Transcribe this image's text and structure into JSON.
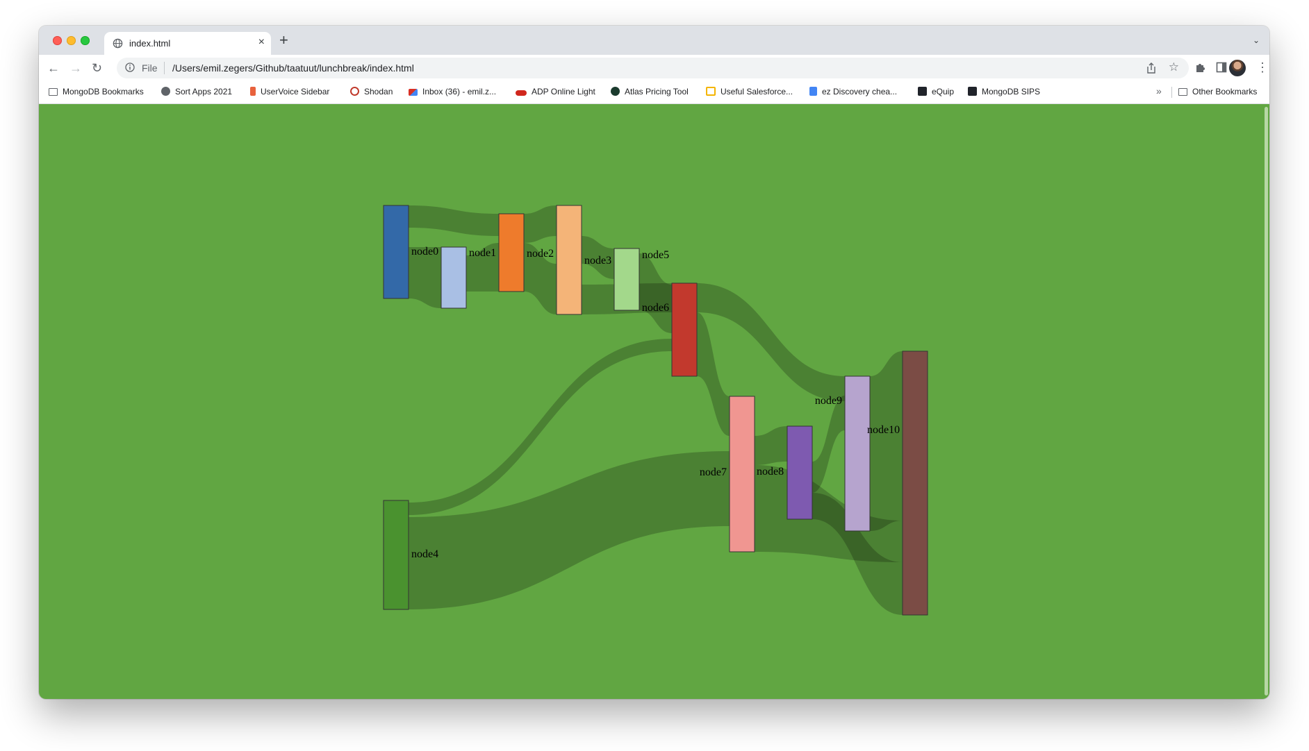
{
  "browser": {
    "tab_title": "index.html",
    "tab_close": "×",
    "new_tab": "+",
    "tab_search": "⌄",
    "back": "←",
    "forward": "→",
    "reload": "↻",
    "file_label": "File",
    "url": "/Users/emil.zegers/Github/taatuut/lunchbreak/index.html",
    "star": "☆",
    "menu": "⋮"
  },
  "bookmarks": [
    {
      "label": "MongoDB Bookmarks",
      "icon": "folder-icon",
      "color": "#5f6368"
    },
    {
      "label": "Sort Apps 2021",
      "icon": "globe-icon",
      "color": "#5f6368"
    },
    {
      "label": "UserVoice Sidebar",
      "icon": "uservoice-icon",
      "color": "#e8623d"
    },
    {
      "label": "Shodan",
      "icon": "shodan-icon",
      "color": "#c0392b"
    },
    {
      "label": "Inbox (36) - emil.z...",
      "icon": "gmail-icon",
      "color": "#d93025"
    },
    {
      "label": "ADP Online Light",
      "icon": "adp-icon",
      "color": "#d0271d"
    },
    {
      "label": "Atlas Pricing Tool",
      "icon": "mongodb-leaf-icon",
      "color": "#1b3b2e"
    },
    {
      "label": "Useful Salesforce...",
      "icon": "slides-icon",
      "color": "#f4b400"
    },
    {
      "label": "ez Discovery chea...",
      "icon": "docs-icon",
      "color": "#4285f4"
    },
    {
      "label": "eQuip",
      "icon": "react-icon",
      "color": "#20232a"
    },
    {
      "label": "MongoDB SIPS",
      "icon": "react-icon",
      "color": "#20232a"
    }
  ],
  "bookmarks_more": "»",
  "other_bookmarks": "Other Bookmarks",
  "chart_data": {
    "type": "sankey",
    "title": "",
    "nodes": [
      {
        "name": "node0",
        "color": "#3369a8"
      },
      {
        "name": "node1",
        "color": "#a9bfe4"
      },
      {
        "name": "node2",
        "color": "#ee7b2c"
      },
      {
        "name": "node3",
        "color": "#f4b478"
      },
      {
        "name": "node4",
        "color": "#4a922f"
      },
      {
        "name": "node5",
        "color": "#a3d88b"
      },
      {
        "name": "node6",
        "color": "#c2392d"
      },
      {
        "name": "node7",
        "color": "#f09691"
      },
      {
        "name": "node8",
        "color": "#7e5ab0"
      },
      {
        "name": "node9",
        "color": "#b6a4ce"
      },
      {
        "name": "node10",
        "color": "#7b4c45"
      }
    ],
    "links": [
      {
        "source": 0,
        "target": 2,
        "value": 2
      },
      {
        "source": 0,
        "target": 1,
        "value": 2
      },
      {
        "source": 1,
        "target": 2,
        "value": 2
      },
      {
        "source": 2,
        "target": 3,
        "value": 2
      },
      {
        "source": 2,
        "target": 3,
        "value": 2
      },
      {
        "source": 3,
        "target": 5,
        "value": 2
      },
      {
        "source": 3,
        "target": 6,
        "value": 2
      },
      {
        "source": 4,
        "target": 6,
        "value": 1
      },
      {
        "source": 4,
        "target": 7,
        "value": 3
      },
      {
        "source": 5,
        "target": 6,
        "value": 2
      },
      {
        "source": 6,
        "target": 9,
        "value": 2
      },
      {
        "source": 6,
        "target": 7,
        "value": 3
      },
      {
        "source": 7,
        "target": 8,
        "value": 3
      },
      {
        "source": 7,
        "target": 10,
        "value": 2
      },
      {
        "source": 8,
        "target": 9,
        "value": 1
      },
      {
        "source": 8,
        "target": 10,
        "value": 2
      },
      {
        "source": 9,
        "target": 10,
        "value": 3
      }
    ]
  }
}
